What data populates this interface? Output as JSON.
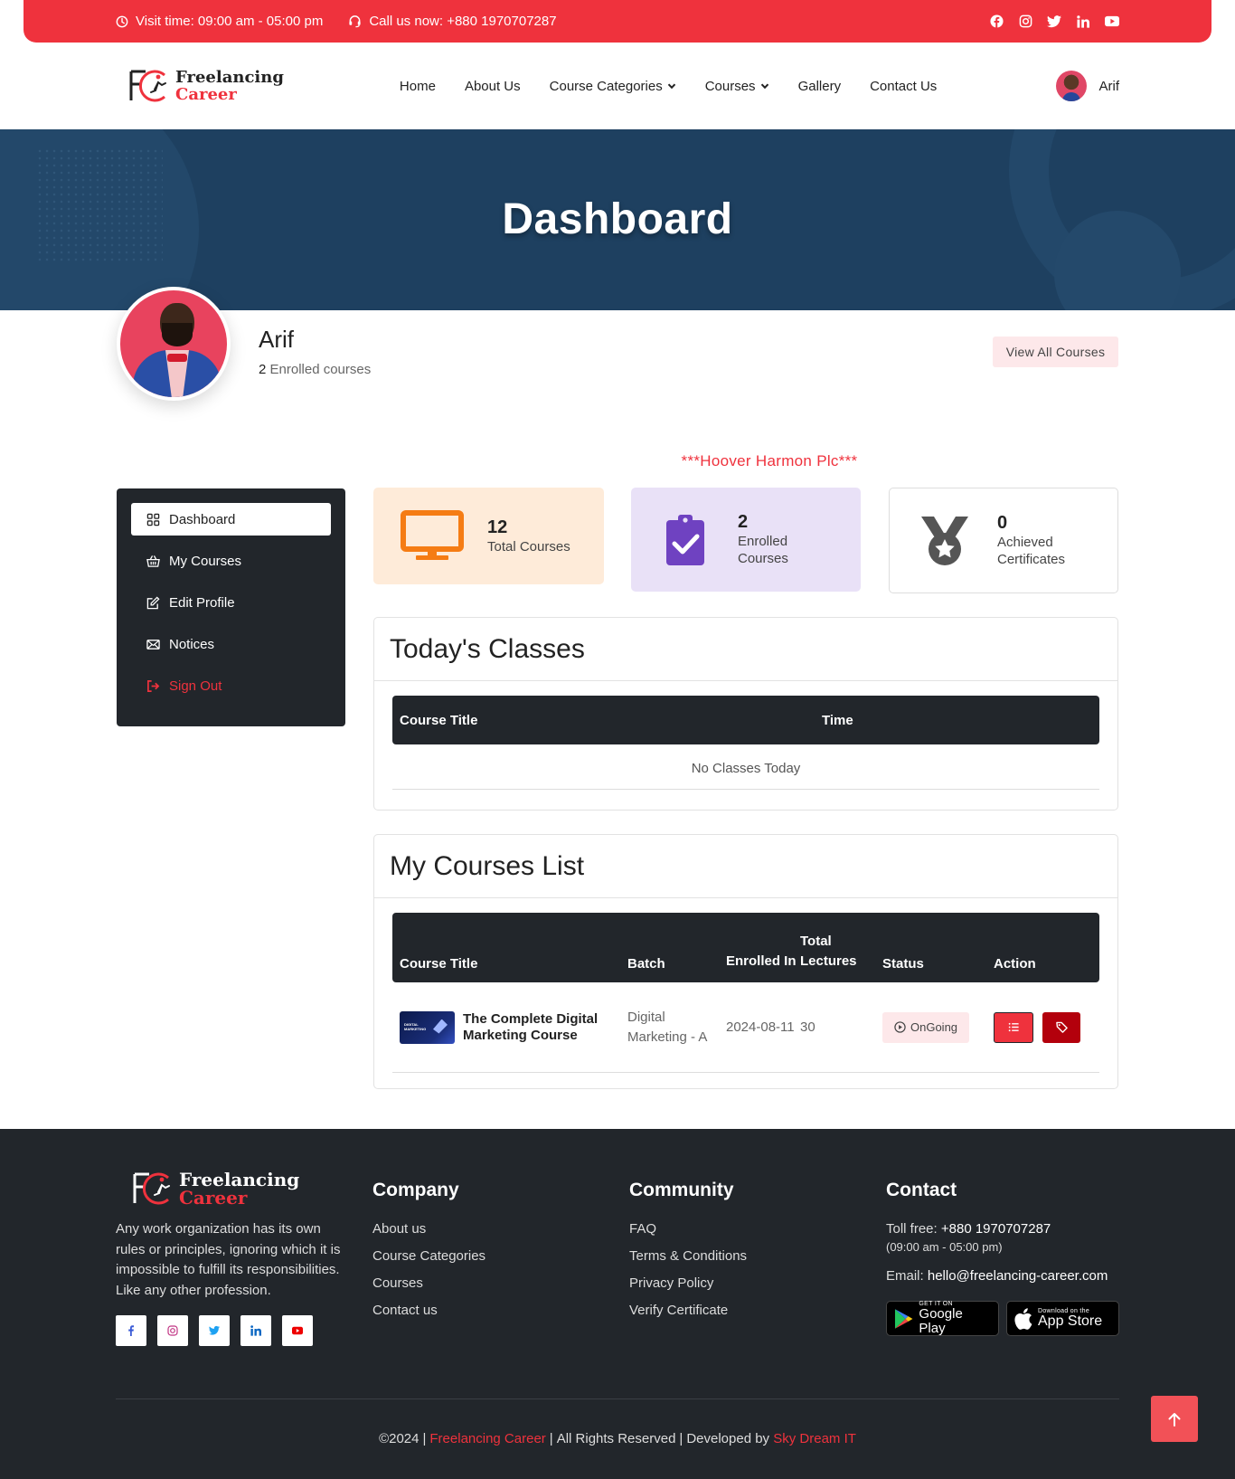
{
  "topbar": {
    "visit_time": "Visit time: 09:00 am - 05:00 pm",
    "call": "Call us now: +880 1970707287",
    "socials": [
      "facebook-icon",
      "instagram-icon",
      "twitter-icon",
      "linkedin-icon",
      "youtube-icon"
    ]
  },
  "brand": {
    "line1": "Freelancing",
    "line2": "Career",
    "accent": "#ef323d",
    "dark": "#22262b",
    "hero_bg": "#1e4060"
  },
  "nav": {
    "items": [
      "Home",
      "About Us",
      "Course Categories",
      "Courses",
      "Gallery",
      "Contact Us"
    ],
    "user_name": "Arif"
  },
  "hero": {
    "title": "Dashboard"
  },
  "profile": {
    "name": "Arif",
    "enrolled_count": "2",
    "enrolled_text": "Enrolled courses",
    "view_all": "View All Courses"
  },
  "company_tag": "***Hoover Harmon Plc***",
  "sidebar": {
    "items": [
      {
        "label": "Dashboard",
        "icon": "dashboard-grid-icon"
      },
      {
        "label": "My Courses",
        "icon": "basket-icon"
      },
      {
        "label": "Edit Profile",
        "icon": "edit-icon"
      },
      {
        "label": "Notices",
        "icon": "envelope-icon"
      },
      {
        "label": "Sign Out",
        "icon": "sign-out-icon"
      }
    ]
  },
  "stats": [
    {
      "value": "12",
      "label": "Total Courses",
      "icon": "monitor-icon",
      "bg": "#feebd9"
    },
    {
      "value": "2",
      "label": "Enrolled Courses",
      "icon": "clipboard-check-icon",
      "bg": "#e9e1f7"
    },
    {
      "value": "0",
      "label": "Achieved Certificates",
      "icon": "medal-icon",
      "bg": "#ffffff"
    }
  ],
  "todays_classes": {
    "title": "Today's Classes",
    "headers": [
      "Course Title",
      "Time"
    ],
    "empty": "No Classes Today"
  },
  "my_courses": {
    "title": "My Courses List",
    "headers": [
      "Course Title",
      "Batch",
      "Enrolled In",
      "Total Lectures",
      "Status",
      "Action"
    ],
    "rows": [
      {
        "title": "The Complete Digital Marketing Course",
        "batch": "Digital Marketing - A",
        "enrolled": "2024-08-11",
        "lectures": "30",
        "status": "OnGoing"
      }
    ]
  },
  "footer": {
    "about_text": "Any work organization has its own rules or principles, ignoring which it is impossible to fulfill its responsibilities. Like any other profession.",
    "company_title": "Company",
    "company_links": [
      "About us",
      "Course Categories",
      "Courses",
      "Contact us"
    ],
    "community_title": "Community",
    "community_links": [
      "FAQ",
      "Terms & Conditions",
      "Privacy Policy",
      "Verify Certificate"
    ],
    "contact_title": "Contact",
    "toll_label": "Toll free:",
    "toll_number": "+880 1970707287",
    "hours": "(09:00 am - 05:00 pm)",
    "email_label": "Email:",
    "email": "hello@freelancing-career.com",
    "google_small": "GET IT ON",
    "google_big": "Google Play",
    "apple_small": "Download on the",
    "apple_big": "App Store",
    "copy_year": "©2024",
    "copy_brand": "Freelancing Career",
    "copy_rights": "All Rights Reserved",
    "copy_dev": "Developed by",
    "copy_dev_name": "Sky Dream IT"
  }
}
